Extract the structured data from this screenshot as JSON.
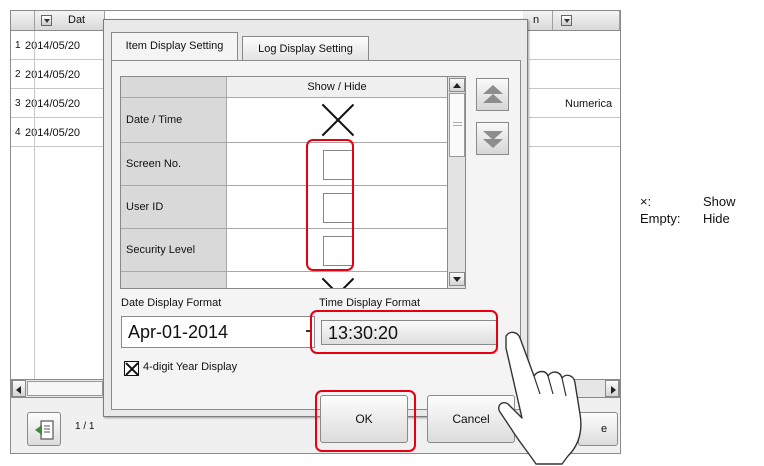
{
  "background": {
    "header_col1": "Dat",
    "header_col2": "n",
    "rows": [
      {
        "num": "1",
        "date": "2014/05/20",
        "extra": ""
      },
      {
        "num": "2",
        "date": "2014/05/20",
        "extra": ""
      },
      {
        "num": "3",
        "date": "2014/05/20",
        "extra": "Numerica"
      },
      {
        "num": "4",
        "date": "2014/05/20",
        "extra": ""
      }
    ],
    "page_indicator": "1 / 1",
    "right_button_partial": "e"
  },
  "dialog": {
    "tabs": [
      {
        "label": "Item Display Setting",
        "active": true
      },
      {
        "label": "Log Display Setting",
        "active": false
      }
    ],
    "table_header": "Show / Hide",
    "items": [
      {
        "label": "Date / Time",
        "shown": true
      },
      {
        "label": "Screen No.",
        "shown": false
      },
      {
        "label": "User ID",
        "shown": false
      },
      {
        "label": "Security Level",
        "shown": false
      }
    ],
    "date_format_label": "Date Display Format",
    "time_format_label": "Time Display Format",
    "date_format_value": "Apr-01-2014",
    "time_format_value": "13:30:20",
    "four_digit_label": "4-digit Year Display",
    "four_digit_checked": true,
    "ok_label": "OK",
    "cancel_label": "Cancel"
  },
  "legend": [
    {
      "key": "×:",
      "value": "Show"
    },
    {
      "key": "Empty:",
      "value": "Hide"
    }
  ],
  "colors": {
    "highlight": "#e60012"
  }
}
